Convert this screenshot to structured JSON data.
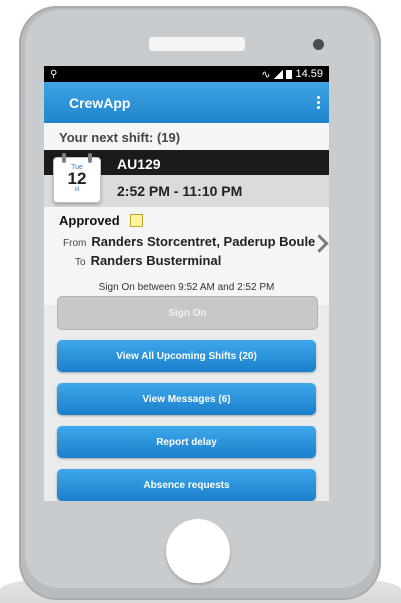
{
  "status_bar": {
    "time": "14.59"
  },
  "app_bar": {
    "title": "CrewApp"
  },
  "next_shift": {
    "heading": "Your next shift: (19)",
    "calendar": {
      "dow": "Tue",
      "day": "12",
      "month": "ill"
    },
    "code": "AU129",
    "time": "2:52 PM - 11:10 PM",
    "status": "Approved",
    "from_label": "From",
    "from": "Randers Storcentret, Paderup Boule",
    "to_label": "To",
    "to": "Randers Busterminal",
    "signon_note": "Sign On between 9:52 AM and 2:52 PM"
  },
  "buttons": {
    "sign_on": "Sign On",
    "view_shifts": "View All Upcoming Shifts (20)",
    "view_messages": "View Messages (6)",
    "report_delay": "Report delay",
    "absence": "Absence requests"
  },
  "colors": {
    "accent": "#1f84cc",
    "header_dark": "#1b1b1b"
  }
}
